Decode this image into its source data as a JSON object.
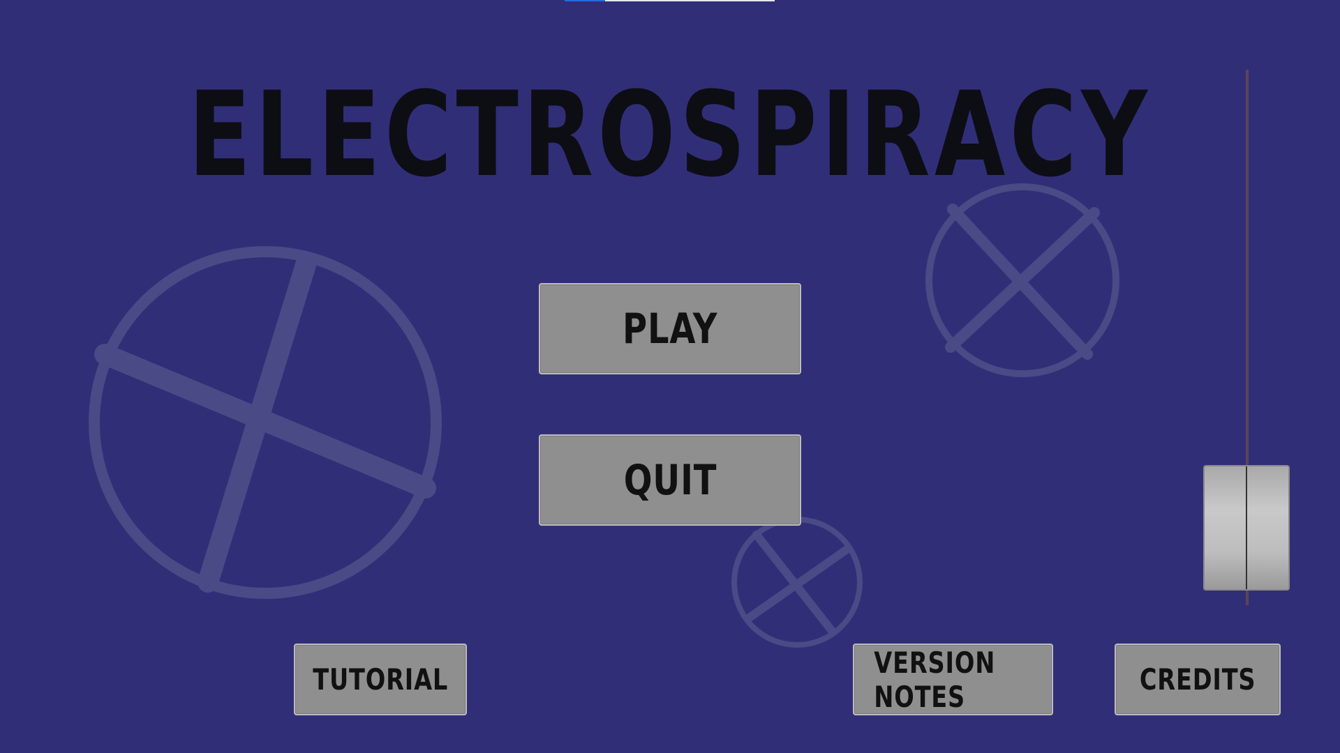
{
  "game": {
    "title": "ELECTROSPIRACY"
  },
  "menu": {
    "play_label": "PLAY",
    "quit_label": "QUIT",
    "tutorial_label": "TUTORIAL",
    "version_notes_label": "VERSION NOTES",
    "credits_label": "CREDITS"
  },
  "volume_slider": {
    "orientation": "vertical",
    "level": 0.2
  },
  "colors": {
    "background": "#312e78",
    "button": "#8f8f8f",
    "title": "#0d0d14",
    "gear": "#4a4a86"
  },
  "decor": {
    "gear_icons": [
      "gear-icon",
      "gear-icon",
      "gear-icon"
    ]
  }
}
